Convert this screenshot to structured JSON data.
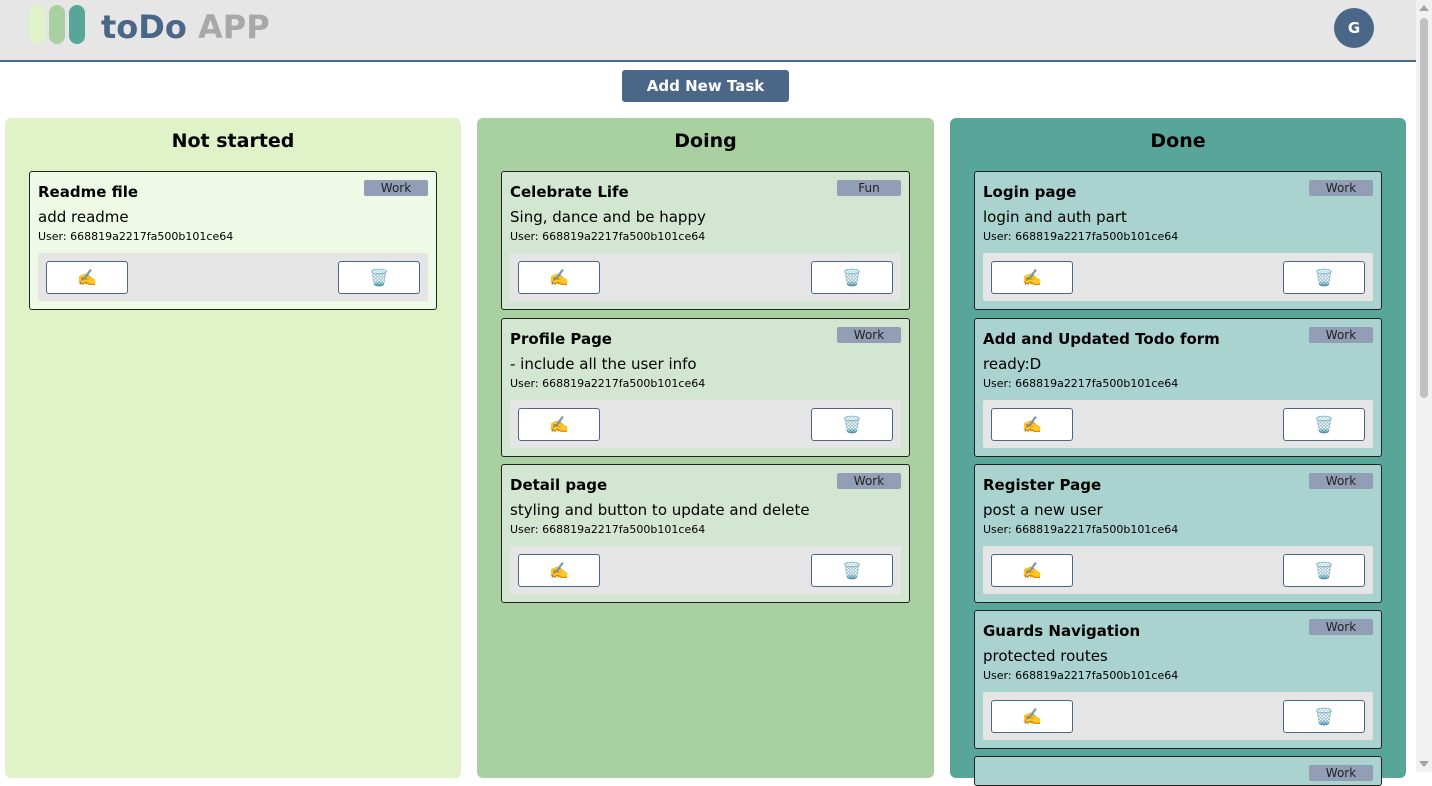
{
  "app": {
    "brand": "toDo",
    "app": "APP",
    "avatar_initial": "G"
  },
  "toolbar": {
    "add_label": "Add New Task"
  },
  "icons": {
    "edit": "writing-hand-icon",
    "delete": "trash-icon"
  },
  "colors": {
    "primary": "#4a6787",
    "not_started_bg": "#e0f2c8",
    "doing_bg": "#a8d0a0",
    "done_bg": "#58a59a"
  },
  "columns": [
    {
      "title": "Not started",
      "cards": [
        {
          "title": "Readme file",
          "tag": "Work",
          "desc": "add readme",
          "user": "User: 668819a2217fa500b101ce64"
        }
      ]
    },
    {
      "title": "Doing",
      "cards": [
        {
          "title": "Celebrate Life",
          "tag": "Fun",
          "desc": "Sing, dance and be happy",
          "user": "User: 668819a2217fa500b101ce64"
        },
        {
          "title": "Profile Page",
          "tag": "Work",
          "desc": "- include all the user info",
          "user": "User: 668819a2217fa500b101ce64"
        },
        {
          "title": "Detail page",
          "tag": "Work",
          "desc": "styling and button to update and delete",
          "user": "User: 668819a2217fa500b101ce64"
        }
      ]
    },
    {
      "title": "Done",
      "cards": [
        {
          "title": "Login page",
          "tag": "Work",
          "desc": "login and auth part",
          "user": "User: 668819a2217fa500b101ce64"
        },
        {
          "title": "Add and Updated Todo form",
          "tag": "Work",
          "desc": "ready:D",
          "user": "User: 668819a2217fa500b101ce64"
        },
        {
          "title": "Register Page",
          "tag": "Work",
          "desc": "post a new user",
          "user": "User: 668819a2217fa500b101ce64"
        },
        {
          "title": "Guards Navigation",
          "tag": "Work",
          "desc": "protected routes",
          "user": "User: 668819a2217fa500b101ce64"
        },
        {
          "title": "",
          "tag": "Work",
          "desc": "",
          "user": ""
        }
      ]
    }
  ]
}
